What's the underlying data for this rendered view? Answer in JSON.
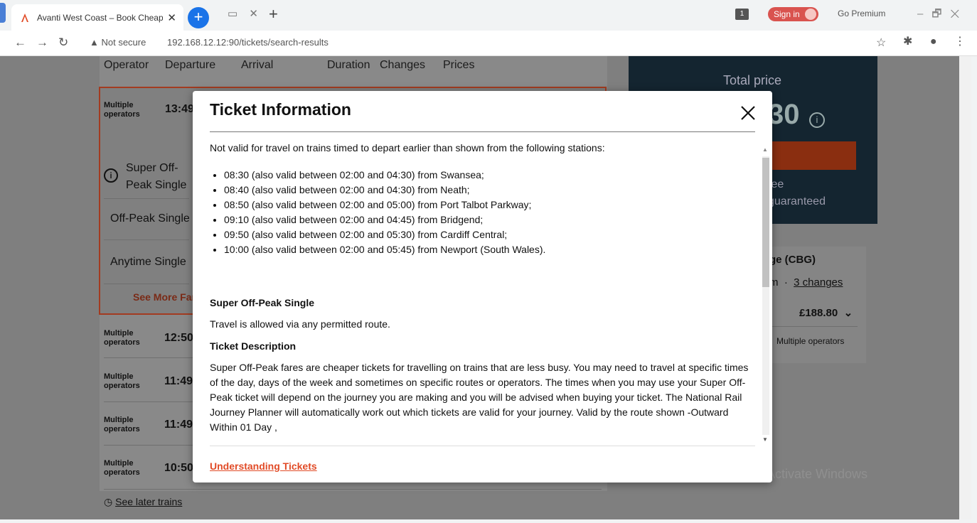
{
  "browser": {
    "tab_title": "Avanti West Coast – Book Cheap",
    "tab_close": "✕",
    "new_tab_plus": "+",
    "add_tab": "+",
    "tab_controls": "▭ ✕",
    "badge_count": "1",
    "sign_in": "Sign in",
    "go_premium": "Go Premium",
    "window_controls": "–🗗✕",
    "nav": "←→↻",
    "not_secure": "▲ Not secure",
    "url": "192.168.12.12:90/tickets/search-results",
    "star": "☆",
    "ext_icons": "✱ ● ⋮"
  },
  "results": {
    "headers": {
      "operator": "Operator",
      "departure": "Departure",
      "arrival": "Arrival",
      "duration": "Duration",
      "changes": "Changes",
      "prices": "Prices"
    },
    "selected": {
      "operator": "Multiple operators",
      "time": "13:49",
      "fares": [
        "Super Off-Peak Single",
        "Off-Peak Single",
        "Anytime Single"
      ],
      "see_more": "See More Far"
    },
    "rows": [
      {
        "operator": "Multiple operators",
        "time": "12:50"
      },
      {
        "operator": "Multiple operators",
        "time": "11:49"
      },
      {
        "operator": "Multiple operators",
        "time": "11:49"
      },
      {
        "operator": "Multiple operators",
        "time": "10:50"
      }
    ],
    "see_later": "See later trains"
  },
  "summary": {
    "total_label": "Total price",
    "price_partial": "30",
    "fee_partial": "fee",
    "guaranteed_partial": "guaranteed",
    "station_partial": "ge (CBG)",
    "duration_partial": "m",
    "changes_link": "3 changes",
    "price": "£188.80",
    "operators": "Multiple operators",
    "activate": "Activate Windows"
  },
  "modal": {
    "title": "Ticket Information",
    "intro": "Not valid for travel on trains timed to depart earlier than shown from the following stations:",
    "restrictions": [
      "08:30 (also valid between 02:00 and 04:30) from Swansea;",
      "08:40 (also valid between 02:00 and 04:30) from Neath;",
      "08:50 (also valid between 02:00 and 05:00) from Port Talbot Parkway;",
      "09:10 (also valid between 02:00 and 04:45) from Bridgend;",
      "09:50 (also valid between 02:00 and 05:30) from Cardiff Central;",
      "10:00 (also valid between 02:00 and 05:45) from Newport (South Wales)."
    ],
    "ticket_name": "Super Off-Peak Single",
    "route_text": "Travel is allowed via any permitted route.",
    "desc_heading": "Ticket Description",
    "description": "Super Off-Peak fares are cheaper tickets for travelling on trains that are less busy. You may need to travel at specific times of the day, days of the week and sometimes on specific routes or operators. The times when you may use your Super Off-Peak ticket will depend on the journey you are making and you will be advised when buying your ticket. The National Rail Journey Planner will automatically work out which tickets are valid for your journey. Valid by the route shown -Outward Within 01 Day ,",
    "footer_link": "Understanding Tickets"
  },
  "colors": {
    "accent": "#e14b27",
    "brand_dark": "#142530",
    "chrome_blue": "#1a73e8"
  }
}
